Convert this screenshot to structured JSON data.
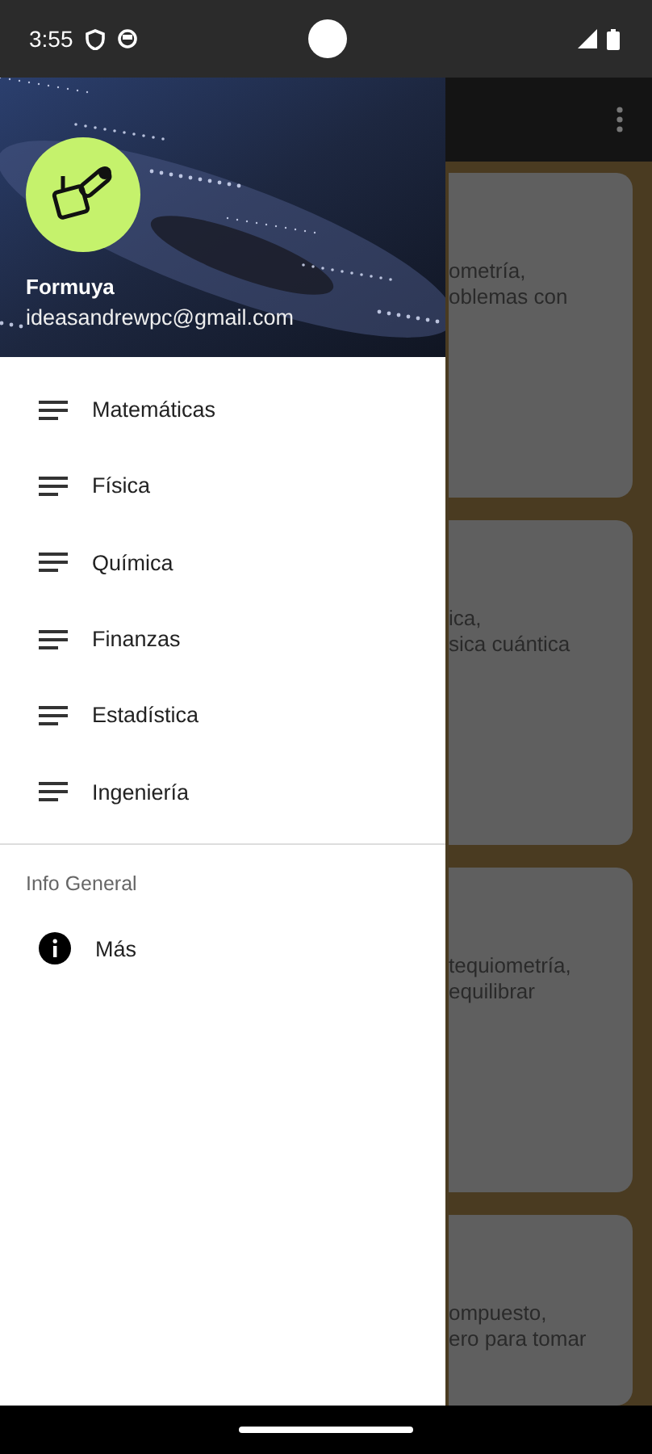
{
  "status_bar": {
    "time": "3:55"
  },
  "drawer": {
    "header": {
      "title": "Formuya",
      "email": "ideasandrewpc@gmail.com"
    },
    "items": [
      {
        "label": "Matemáticas",
        "kind": "list"
      },
      {
        "label": "Física",
        "kind": "list"
      },
      {
        "label": "Química",
        "kind": "list"
      },
      {
        "label": "Finanzas",
        "kind": "list"
      },
      {
        "label": "Estadística",
        "kind": "list"
      },
      {
        "label": "Ingeniería",
        "kind": "list"
      }
    ],
    "section": {
      "title": "Info General",
      "items": [
        {
          "label": "Más",
          "kind": "info"
        }
      ]
    }
  },
  "cards": [
    {
      "lines": [
        "ometría,",
        "oblemas con"
      ]
    },
    {
      "lines": [
        "ica,",
        "sica cuántica"
      ]
    },
    {
      "lines": [
        "tequiometría,",
        "equilibrar"
      ]
    },
    {
      "lines": [
        "ompuesto,",
        "ero para tomar"
      ]
    }
  ]
}
